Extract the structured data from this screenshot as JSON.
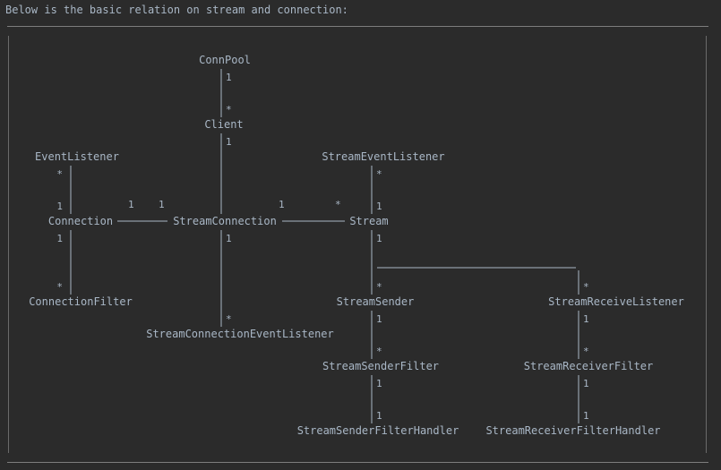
{
  "header": {
    "text": "Below is the basic relation on stream and connection:"
  },
  "diagram": {
    "nodes": [
      {
        "id": "conn_pool",
        "label": "ConnPool"
      },
      {
        "id": "client",
        "label": "Client"
      },
      {
        "id": "event_listener",
        "label": "EventListener"
      },
      {
        "id": "stream_event_listener",
        "label": "StreamEventListener"
      },
      {
        "id": "connection",
        "label": "Connection"
      },
      {
        "id": "stream_connection",
        "label": "StreamConnection"
      },
      {
        "id": "stream",
        "label": "Stream"
      },
      {
        "id": "connection_filter",
        "label": "ConnectionFilter"
      },
      {
        "id": "stream_sender",
        "label": "StreamSender"
      },
      {
        "id": "stream_receive_listener",
        "label": "StreamReceiveListener"
      },
      {
        "id": "stream_connection_event_listener",
        "label": "StreamConnectionEventListener"
      },
      {
        "id": "stream_sender_filter",
        "label": "StreamSenderFilter"
      },
      {
        "id": "stream_receiver_filter",
        "label": "StreamReceiverFilter"
      },
      {
        "id": "stream_sender_filter_handler",
        "label": "StreamSenderFilterHandler"
      },
      {
        "id": "stream_receiver_filter_handler",
        "label": "StreamReceiverFilterHandler"
      }
    ],
    "edges": [
      {
        "from": "conn_pool",
        "to": "client",
        "from_mult": "1",
        "to_mult": "*"
      },
      {
        "from": "client",
        "to": "stream_connection",
        "from_mult": "1",
        "to_mult": ""
      },
      {
        "from": "event_listener",
        "to": "connection",
        "from_mult": "*",
        "to_mult": "1"
      },
      {
        "from": "stream_event_listener",
        "to": "stream",
        "from_mult": "*",
        "to_mult": "1"
      },
      {
        "from": "connection",
        "to": "stream_connection",
        "from_mult": "1",
        "to_mult": "1"
      },
      {
        "from": "stream_connection",
        "to": "stream",
        "from_mult": "1",
        "to_mult": "*"
      },
      {
        "from": "connection",
        "to": "connection_filter",
        "from_mult": "1",
        "to_mult": "*"
      },
      {
        "from": "stream_connection",
        "to": "stream_connection_event_listener",
        "from_mult": "1",
        "to_mult": "*"
      },
      {
        "from": "stream",
        "to": "stream_sender",
        "from_mult": "1",
        "to_mult": "*"
      },
      {
        "from": "stream",
        "to": "stream_receive_listener",
        "from_mult": "",
        "to_mult": "*"
      },
      {
        "from": "stream_sender",
        "to": "stream_sender_filter",
        "from_mult": "1",
        "to_mult": "*"
      },
      {
        "from": "stream_receive_listener",
        "to": "stream_receiver_filter",
        "from_mult": "1",
        "to_mult": "*"
      },
      {
        "from": "stream_sender_filter",
        "to": "stream_sender_filter_handler",
        "from_mult": "1",
        "to_mult": "1"
      },
      {
        "from": "stream_receiver_filter",
        "to": "stream_receiver_filter_handler",
        "from_mult": "1",
        "to_mult": "1"
      }
    ]
  }
}
